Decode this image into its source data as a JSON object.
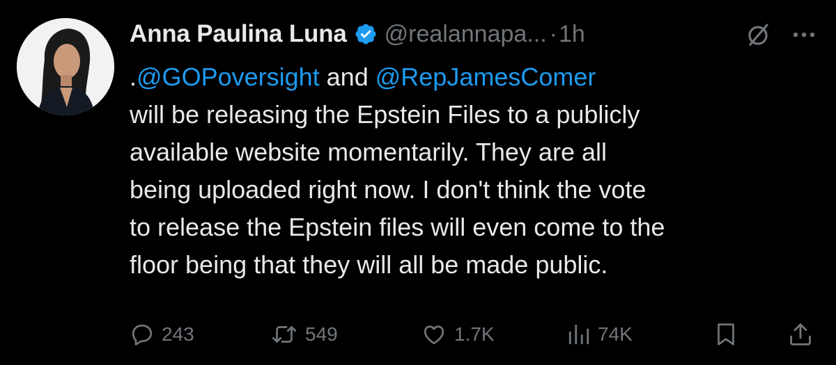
{
  "tweet": {
    "author": {
      "display_name": "Anna Paulina Luna",
      "handle": "@realannapa...",
      "verified_icon": "verified-badge-icon",
      "avatar": "avatar"
    },
    "separator": "·",
    "time": "1h",
    "body": {
      "line1_prefix": ".",
      "mention1": "@GOPoversight",
      "line1_mid": " and ",
      "mention2": "@RepJamesComer",
      "line2": "will be releasing the Epstein Files to a publicly",
      "line3": "available website momentarily. They are all",
      "line4": "being uploaded right now. I don't think the vote",
      "line5": "to release the Epstein files will even come to the",
      "line6": "floor being that they will all be made public."
    },
    "actions": {
      "replies": "243",
      "reposts": "549",
      "likes": "1.7K",
      "views": "74K"
    }
  },
  "colors": {
    "background": "#000000",
    "text": "#e7e9ea",
    "secondary": "#71767b",
    "accent": "#1d9bf0"
  },
  "icons": {
    "grok": "grok-icon",
    "more": "more-icon",
    "reply": "reply-icon",
    "repost": "repost-icon",
    "like": "like-icon",
    "views": "views-icon",
    "bookmark": "bookmark-icon",
    "share": "share-icon"
  }
}
